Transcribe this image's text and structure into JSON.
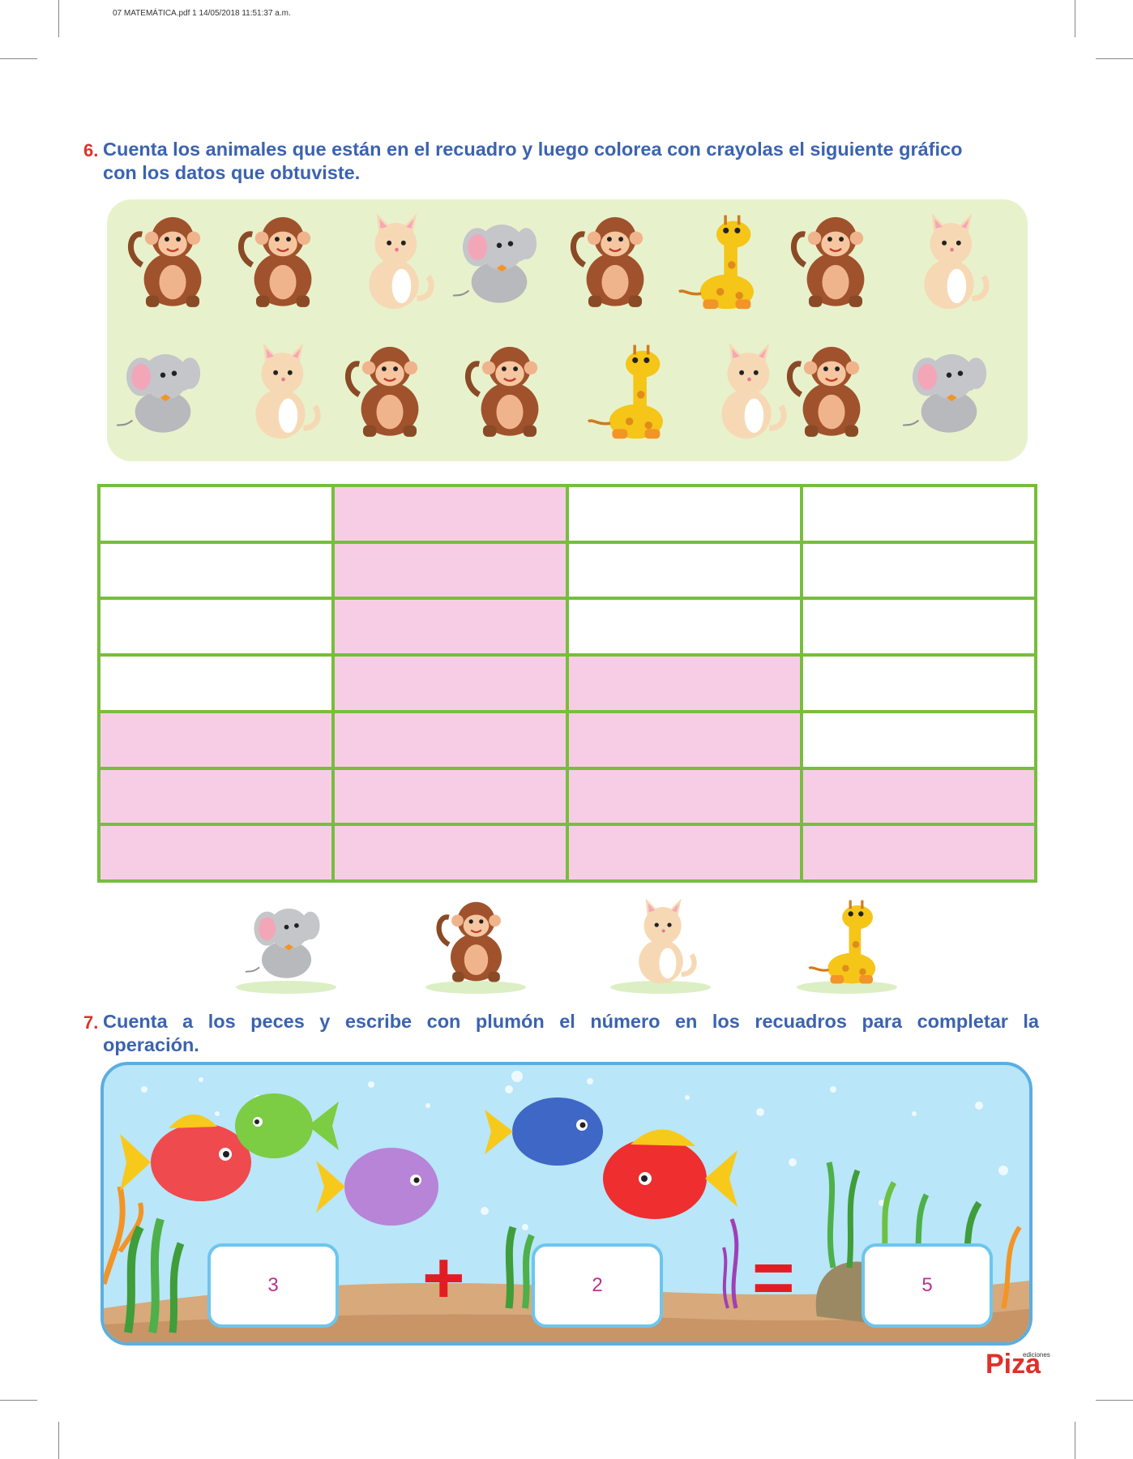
{
  "header": {
    "meta": "07 MATEMÁTICA.pdf   1   14/05/2018   11:51:37 a.m."
  },
  "q6": {
    "number": "6.",
    "text_line1": "Cuenta los animales que están en el recuadro y luego colorea con crayolas el siguiente gráfico",
    "text_line2": "con los datos que obtuviste.",
    "animals_row1": [
      "monkey",
      "monkey",
      "cat",
      "elephant",
      "monkey",
      "giraffe",
      "monkey",
      "cat"
    ],
    "animals_row2": [
      "elephant",
      "cat",
      "monkey",
      "monkey",
      "giraffe",
      "cat",
      "monkey",
      "elephant"
    ],
    "chart_columns": [
      "elephant",
      "monkey",
      "cat",
      "giraffe"
    ],
    "chart_rows": 7,
    "column_counts": [
      3,
      7,
      4,
      2
    ],
    "fill_color": "#f7cde6",
    "grid_color": "#77be3c"
  },
  "q7": {
    "number": "7.",
    "text_line1": "Cuenta a los peces y escribe con plumón el número en los recuadros para completar la",
    "text_line2": "operación.",
    "box1": "3",
    "box2": "2",
    "box3": "5",
    "plus": "+",
    "equals": "="
  },
  "footer": {
    "logo_main": "Piza",
    "logo_small": "ediciones"
  }
}
